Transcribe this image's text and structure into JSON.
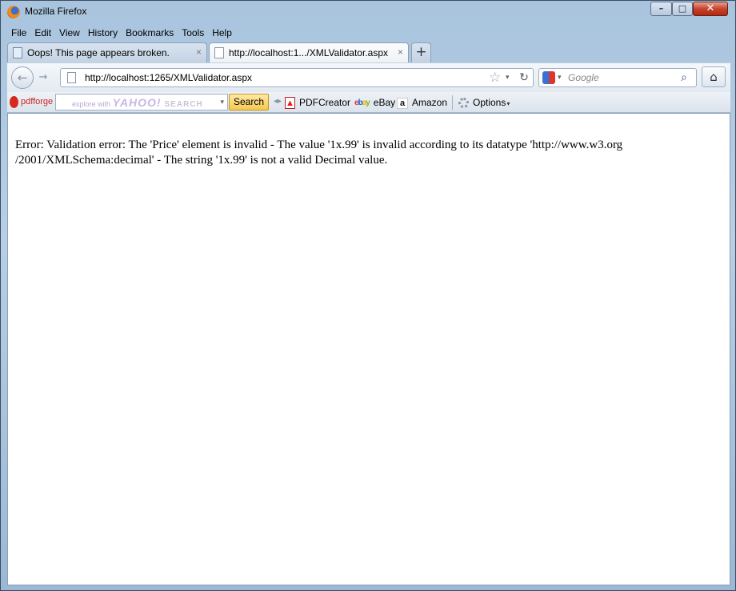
{
  "window": {
    "title": "Mozilla Firefox"
  },
  "menu": [
    "File",
    "Edit",
    "View",
    "History",
    "Bookmarks",
    "Tools",
    "Help"
  ],
  "tabs": [
    {
      "label": "Oops! This page appears broken.",
      "close": "×"
    },
    {
      "label": "http://localhost:1.../XMLValidator.aspx",
      "close": "×"
    }
  ],
  "new_tab": "+",
  "nav": {
    "url": "http://localhost:1265/XMLValidator.aspx",
    "search_placeholder": "Google"
  },
  "toolbar": {
    "brand": "pdfforge",
    "yahoo_prefix": "explore with",
    "yahoo_brand": "YAHOO!",
    "yahoo_suffix": "SEARCH",
    "search_button": "Search",
    "pdfcreator": "PDFCreator",
    "ebay": "eBay",
    "amazon": "Amazon",
    "options": "Options"
  },
  "content": {
    "line1": "Error: Validation error: The 'Price' element is invalid - The value '1x.99' is invalid according to its datatype 'http://www.w3.org",
    "line2": "/2001/XMLSchema:decimal' - The string '1x.99' is not a valid Decimal value."
  }
}
